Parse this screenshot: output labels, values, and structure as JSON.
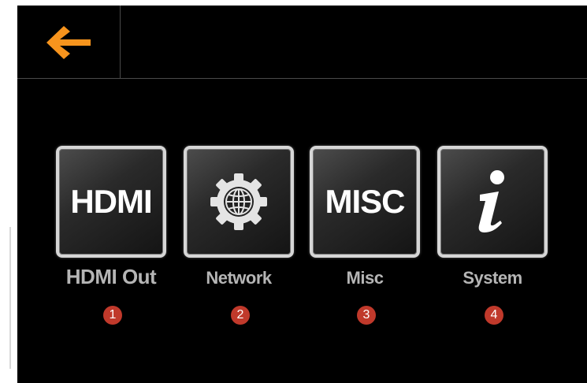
{
  "menu": {
    "items": [
      {
        "icon_text": "HDMI",
        "label": "HDMI Out",
        "badge": "1"
      },
      {
        "icon": "network-gear-globe-icon",
        "label": "Network",
        "badge": "2"
      },
      {
        "icon_text": "MISC",
        "label": "Misc",
        "badge": "3"
      },
      {
        "icon": "info-icon",
        "label": "System",
        "badge": "4"
      }
    ]
  },
  "colors": {
    "back_arrow": "#f7941d",
    "badge": "#c0392b",
    "label": "#b5b5b5"
  }
}
